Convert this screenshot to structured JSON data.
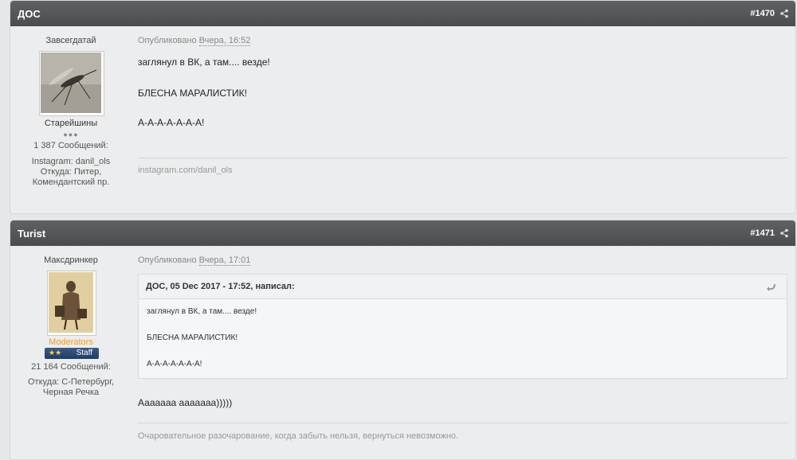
{
  "post1": {
    "author": "ДОС",
    "post_number": "#1470",
    "user_title": "Завсегдатай",
    "group": "Старейшины",
    "pips": "●●●",
    "posts_count": "1 387 Сообщений:",
    "instagram": "Instagram: danil_ols",
    "location_line1": "Откуда: Питер,",
    "location_line2": "Комендантский пр.",
    "published_label": "Опубликовано",
    "date": "Вчера, 16:52",
    "lines": [
      "заглянул в ВК, а там.... везде!",
      "БЛЕСНА МАРАЛИСТИК!",
      "А-А-А-А-А-А-А!"
    ],
    "signature": "instagram.com/danil_ols",
    "share_icon": "share-icon"
  },
  "post2": {
    "author": "Turist",
    "post_number": "#1471",
    "user_title": "Максдринкер",
    "group": "Moderators",
    "badge_stars": "★★",
    "badge_label": "Staff",
    "posts_count": "21 164 Сообщений:",
    "location_line1": "Откуда: С-Петербург,",
    "location_line2": "Черная Речка",
    "published_label": "Опубликовано",
    "date": "Вчера, 17:01",
    "quote": {
      "header": "ДОС, 05 Dec 2017 - 17:52, написал:",
      "lines": [
        "заглянул в ВК, а там.... везде!",
        "БЛЕСНА МАРАЛИСТИК!",
        "А-А-А-А-А-А-А!"
      ],
      "icon": "quote-arrow-icon"
    },
    "reply": "Ааааааа ааааааа)))))",
    "signature": "Очаровательное разочарование, когда забыть нельзя, вернуться невозможно.",
    "share_icon": "share-icon"
  },
  "colors": {
    "header_bg": "#4f5254",
    "moderator": "#f39c12",
    "staff_badge": "#2a4a78"
  }
}
